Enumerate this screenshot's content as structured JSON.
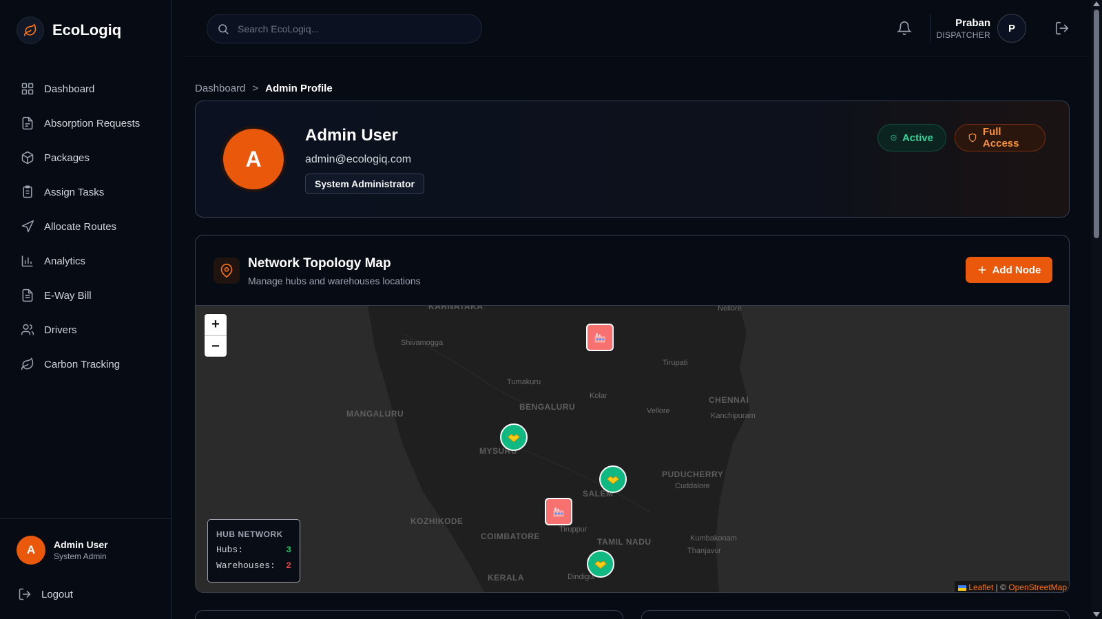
{
  "brand": {
    "name": "EcoLogiq"
  },
  "sidebar": {
    "items": [
      {
        "label": "Dashboard",
        "icon": "dashboard-icon"
      },
      {
        "label": "Absorption Requests",
        "icon": "document-icon"
      },
      {
        "label": "Packages",
        "icon": "package-icon"
      },
      {
        "label": "Assign Tasks",
        "icon": "clipboard-icon"
      },
      {
        "label": "Allocate Routes",
        "icon": "navigation-icon"
      },
      {
        "label": "Analytics",
        "icon": "bar-chart-icon"
      },
      {
        "label": "E-Way Bill",
        "icon": "file-text-icon"
      },
      {
        "label": "Drivers",
        "icon": "users-icon"
      },
      {
        "label": "Carbon Tracking",
        "icon": "leaf-icon"
      }
    ],
    "user": {
      "initial": "A",
      "name": "Admin User",
      "role": "System Admin"
    },
    "logout_label": "Logout"
  },
  "header": {
    "search_placeholder": "Search EcoLogiq...",
    "user": {
      "name": "Praban",
      "role": "DISPATCHER",
      "initial": "P"
    }
  },
  "breadcrumb": {
    "root": "Dashboard",
    "separator": ">",
    "current": "Admin Profile"
  },
  "profile": {
    "initial": "A",
    "name": "Admin User",
    "email": "admin@ecologiq.com",
    "role": "System Administrator",
    "status_badge": "Active",
    "access_badge": "Full Access"
  },
  "map": {
    "title": "Network Topology Map",
    "subtitle": "Manage hubs and warehouses locations",
    "add_button": "Add Node",
    "zoom_in": "+",
    "zoom_out": "−",
    "places": {
      "karnataka": "KARNATAKA",
      "nellore": "Nellore",
      "shivamogga": "Shivamogga",
      "tirupati": "Tirupati",
      "tumakuru": "Tumakuru",
      "kolar": "Kolar",
      "bengaluru": "BENGALURU",
      "chennai": "CHENNAI",
      "mangaluru": "MANGALURU",
      "vellore": "Vellore",
      "kanchipuram": "Kanchipuram",
      "mysuru": "MYSURU",
      "puducherry": "PUDUCHERRY",
      "cuddalore": "Cuddalore",
      "salem": "SALEM",
      "kozhikode": "KOZHIKODE",
      "coimbatore": "COIMBATORE",
      "tiruppur": "Tiruppur",
      "tamilnadu": "TAMIL NADU",
      "kumbakonam": "Kumbakonam",
      "thanjavur": "Thanjavur",
      "kerala": "KERALA",
      "dindigul": "Dindigul"
    },
    "legend": {
      "title": "HUB NETWORK",
      "hubs_label": "Hubs:",
      "hubs_count": "3",
      "warehouses_label": "Warehouses:",
      "warehouses_count": "2"
    },
    "attribution": {
      "leaflet": "Leaflet",
      "separator": "| ©",
      "osm": "OpenStreetMap"
    }
  },
  "colors": {
    "accent": "#ea580c",
    "hub": "#10b981",
    "warehouse": "#f87171",
    "active": "#34d399",
    "background": "#070b14"
  }
}
